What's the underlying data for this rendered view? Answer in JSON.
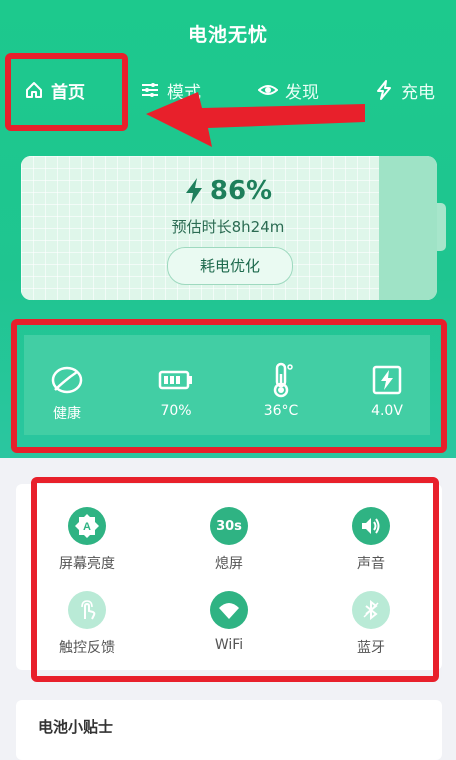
{
  "app": {
    "title": "电池无忧"
  },
  "tabs": [
    {
      "label": "首页",
      "icon": "home-icon"
    },
    {
      "label": "模式",
      "icon": "sliders-icon"
    },
    {
      "label": "发现",
      "icon": "eye-icon"
    },
    {
      "label": "充电",
      "icon": "bolt-icon"
    }
  ],
  "battery": {
    "percent": "86%",
    "level": 0.86,
    "estimate": "预估时长8h24m",
    "optimize_label": "耗电优化"
  },
  "stats": [
    {
      "label": "健康",
      "icon": "leaf-icon"
    },
    {
      "label": "70%",
      "icon": "battery-level-icon"
    },
    {
      "label": "36°C",
      "icon": "thermometer-icon"
    },
    {
      "label": "4.0V",
      "icon": "voltage-icon"
    }
  ],
  "quick_settings": [
    {
      "label": "屏幕亮度",
      "icon": "brightness-icon",
      "glyph": "A"
    },
    {
      "label": "熄屏",
      "icon": "screen-timeout-icon",
      "glyph": "30s"
    },
    {
      "label": "声音",
      "icon": "volume-icon"
    },
    {
      "label": "触控反馈",
      "icon": "touch-feedback-icon"
    },
    {
      "label": "WiFi",
      "icon": "wifi-icon"
    },
    {
      "label": "蓝牙",
      "icon": "bluetooth-icon"
    }
  ],
  "tips": {
    "title": "电池小贴士"
  },
  "colors": {
    "brand": "#1dc98d",
    "highlight": "#e8202b"
  }
}
